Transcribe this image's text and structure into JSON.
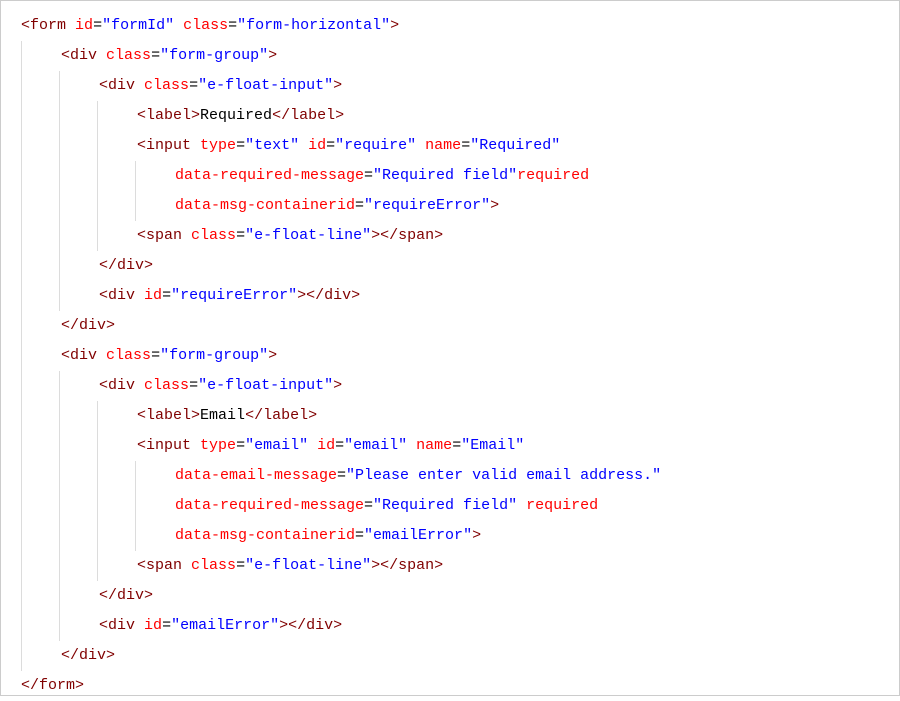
{
  "lines": [
    {
      "indent": 0,
      "segs": [
        {
          "t": "brk",
          "v": "<"
        },
        {
          "t": "name",
          "v": "form"
        },
        {
          "t": "txt",
          "v": " "
        },
        {
          "t": "attr",
          "v": "id"
        },
        {
          "t": "txt",
          "v": "="
        },
        {
          "t": "val",
          "v": "\"formId\""
        },
        {
          "t": "txt",
          "v": " "
        },
        {
          "t": "attr",
          "v": "class"
        },
        {
          "t": "txt",
          "v": "="
        },
        {
          "t": "val",
          "v": "\"form-horizontal\""
        },
        {
          "t": "brk",
          "v": ">"
        }
      ]
    },
    {
      "indent": 1,
      "segs": [
        {
          "t": "brk",
          "v": "<"
        },
        {
          "t": "name",
          "v": "div"
        },
        {
          "t": "txt",
          "v": " "
        },
        {
          "t": "attr",
          "v": "class"
        },
        {
          "t": "txt",
          "v": "="
        },
        {
          "t": "val",
          "v": "\"form-group\""
        },
        {
          "t": "brk",
          "v": ">"
        }
      ]
    },
    {
      "indent": 2,
      "segs": [
        {
          "t": "brk",
          "v": "<"
        },
        {
          "t": "name",
          "v": "div"
        },
        {
          "t": "txt",
          "v": " "
        },
        {
          "t": "attr",
          "v": "class"
        },
        {
          "t": "txt",
          "v": "="
        },
        {
          "t": "val",
          "v": "\"e-float-input\""
        },
        {
          "t": "brk",
          "v": ">"
        }
      ]
    },
    {
      "indent": 3,
      "segs": [
        {
          "t": "brk",
          "v": "<"
        },
        {
          "t": "name",
          "v": "label"
        },
        {
          "t": "brk",
          "v": ">"
        },
        {
          "t": "txt",
          "v": "Required"
        },
        {
          "t": "brk",
          "v": "</"
        },
        {
          "t": "name",
          "v": "label"
        },
        {
          "t": "brk",
          "v": ">"
        }
      ]
    },
    {
      "indent": 3,
      "segs": [
        {
          "t": "brk",
          "v": "<"
        },
        {
          "t": "name",
          "v": "input"
        },
        {
          "t": "txt",
          "v": " "
        },
        {
          "t": "attr",
          "v": "type"
        },
        {
          "t": "txt",
          "v": "="
        },
        {
          "t": "val",
          "v": "\"text\""
        },
        {
          "t": "txt",
          "v": " "
        },
        {
          "t": "attr",
          "v": "id"
        },
        {
          "t": "txt",
          "v": "="
        },
        {
          "t": "val",
          "v": "\"require\""
        },
        {
          "t": "txt",
          "v": " "
        },
        {
          "t": "attr",
          "v": "name"
        },
        {
          "t": "txt",
          "v": "="
        },
        {
          "t": "val",
          "v": "\"Required\""
        }
      ]
    },
    {
      "indent": 3,
      "cont": true,
      "segs": [
        {
          "t": "attr",
          "v": "data-required-message"
        },
        {
          "t": "txt",
          "v": "="
        },
        {
          "t": "val",
          "v": "\"Required field\""
        },
        {
          "t": "attr",
          "v": "required"
        }
      ]
    },
    {
      "indent": 3,
      "cont": true,
      "segs": [
        {
          "t": "attr",
          "v": "data-msg-containerid"
        },
        {
          "t": "txt",
          "v": "="
        },
        {
          "t": "val",
          "v": "\"requireError\""
        },
        {
          "t": "brk",
          "v": ">"
        }
      ]
    },
    {
      "indent": 3,
      "segs": [
        {
          "t": "brk",
          "v": "<"
        },
        {
          "t": "name",
          "v": "span"
        },
        {
          "t": "txt",
          "v": " "
        },
        {
          "t": "attr",
          "v": "class"
        },
        {
          "t": "txt",
          "v": "="
        },
        {
          "t": "val",
          "v": "\"e-float-line\""
        },
        {
          "t": "brk",
          "v": ">"
        },
        {
          "t": "brk",
          "v": "</"
        },
        {
          "t": "name",
          "v": "span"
        },
        {
          "t": "brk",
          "v": ">"
        }
      ]
    },
    {
      "indent": 2,
      "segs": [
        {
          "t": "brk",
          "v": "</"
        },
        {
          "t": "name",
          "v": "div"
        },
        {
          "t": "brk",
          "v": ">"
        }
      ]
    },
    {
      "indent": 2,
      "segs": [
        {
          "t": "brk",
          "v": "<"
        },
        {
          "t": "name",
          "v": "div"
        },
        {
          "t": "txt",
          "v": " "
        },
        {
          "t": "attr",
          "v": "id"
        },
        {
          "t": "txt",
          "v": "="
        },
        {
          "t": "val",
          "v": "\"requireError\""
        },
        {
          "t": "brk",
          "v": ">"
        },
        {
          "t": "brk",
          "v": "</"
        },
        {
          "t": "name",
          "v": "div"
        },
        {
          "t": "brk",
          "v": ">"
        }
      ]
    },
    {
      "indent": 1,
      "segs": [
        {
          "t": "brk",
          "v": "</"
        },
        {
          "t": "name",
          "v": "div"
        },
        {
          "t": "brk",
          "v": ">"
        }
      ]
    },
    {
      "indent": 1,
      "segs": [
        {
          "t": "brk",
          "v": "<"
        },
        {
          "t": "name",
          "v": "div"
        },
        {
          "t": "txt",
          "v": " "
        },
        {
          "t": "attr",
          "v": "class"
        },
        {
          "t": "txt",
          "v": "="
        },
        {
          "t": "val",
          "v": "\"form-group\""
        },
        {
          "t": "brk",
          "v": ">"
        }
      ]
    },
    {
      "indent": 2,
      "segs": [
        {
          "t": "brk",
          "v": "<"
        },
        {
          "t": "name",
          "v": "div"
        },
        {
          "t": "txt",
          "v": " "
        },
        {
          "t": "attr",
          "v": "class"
        },
        {
          "t": "txt",
          "v": "="
        },
        {
          "t": "val",
          "v": "\"e-float-input\""
        },
        {
          "t": "brk",
          "v": ">"
        }
      ]
    },
    {
      "indent": 3,
      "segs": [
        {
          "t": "brk",
          "v": "<"
        },
        {
          "t": "name",
          "v": "label"
        },
        {
          "t": "brk",
          "v": ">"
        },
        {
          "t": "txt",
          "v": "Email"
        },
        {
          "t": "brk",
          "v": "</"
        },
        {
          "t": "name",
          "v": "label"
        },
        {
          "t": "brk",
          "v": ">"
        }
      ]
    },
    {
      "indent": 3,
      "segs": [
        {
          "t": "brk",
          "v": "<"
        },
        {
          "t": "name",
          "v": "input"
        },
        {
          "t": "txt",
          "v": " "
        },
        {
          "t": "attr",
          "v": "type"
        },
        {
          "t": "txt",
          "v": "="
        },
        {
          "t": "val",
          "v": "\"email\""
        },
        {
          "t": "txt",
          "v": " "
        },
        {
          "t": "attr",
          "v": "id"
        },
        {
          "t": "txt",
          "v": "="
        },
        {
          "t": "val",
          "v": "\"email\""
        },
        {
          "t": "txt",
          "v": " "
        },
        {
          "t": "attr",
          "v": "name"
        },
        {
          "t": "txt",
          "v": "="
        },
        {
          "t": "val",
          "v": "\"Email\""
        }
      ]
    },
    {
      "indent": 3,
      "cont": true,
      "segs": [
        {
          "t": "attr",
          "v": "data-email-message"
        },
        {
          "t": "txt",
          "v": "="
        },
        {
          "t": "val",
          "v": "\"Please enter valid email address.\""
        }
      ]
    },
    {
      "indent": 3,
      "cont": true,
      "segs": [
        {
          "t": "attr",
          "v": "data-required-message"
        },
        {
          "t": "txt",
          "v": "="
        },
        {
          "t": "val",
          "v": "\"Required field\""
        },
        {
          "t": "txt",
          "v": " "
        },
        {
          "t": "attr",
          "v": "required"
        }
      ]
    },
    {
      "indent": 3,
      "cont": true,
      "segs": [
        {
          "t": "attr",
          "v": "data-msg-containerid"
        },
        {
          "t": "txt",
          "v": "="
        },
        {
          "t": "val",
          "v": "\"emailError\""
        },
        {
          "t": "brk",
          "v": ">"
        }
      ]
    },
    {
      "indent": 3,
      "segs": [
        {
          "t": "brk",
          "v": "<"
        },
        {
          "t": "name",
          "v": "span"
        },
        {
          "t": "txt",
          "v": " "
        },
        {
          "t": "attr",
          "v": "class"
        },
        {
          "t": "txt",
          "v": "="
        },
        {
          "t": "val",
          "v": "\"e-float-line\""
        },
        {
          "t": "brk",
          "v": ">"
        },
        {
          "t": "brk",
          "v": "</"
        },
        {
          "t": "name",
          "v": "span"
        },
        {
          "t": "brk",
          "v": ">"
        }
      ]
    },
    {
      "indent": 2,
      "segs": [
        {
          "t": "brk",
          "v": "</"
        },
        {
          "t": "name",
          "v": "div"
        },
        {
          "t": "brk",
          "v": ">"
        }
      ]
    },
    {
      "indent": 2,
      "segs": [
        {
          "t": "brk",
          "v": "<"
        },
        {
          "t": "name",
          "v": "div"
        },
        {
          "t": "txt",
          "v": " "
        },
        {
          "t": "attr",
          "v": "id"
        },
        {
          "t": "txt",
          "v": "="
        },
        {
          "t": "val",
          "v": "\"emailError\""
        },
        {
          "t": "brk",
          "v": ">"
        },
        {
          "t": "brk",
          "v": "</"
        },
        {
          "t": "name",
          "v": "div"
        },
        {
          "t": "brk",
          "v": ">"
        }
      ]
    },
    {
      "indent": 1,
      "segs": [
        {
          "t": "brk",
          "v": "</"
        },
        {
          "t": "name",
          "v": "div"
        },
        {
          "t": "brk",
          "v": ">"
        }
      ]
    },
    {
      "indent": 0,
      "segs": [
        {
          "t": "brk",
          "v": "</"
        },
        {
          "t": "name",
          "v": "form"
        },
        {
          "t": "brk",
          "v": ">"
        }
      ]
    }
  ]
}
